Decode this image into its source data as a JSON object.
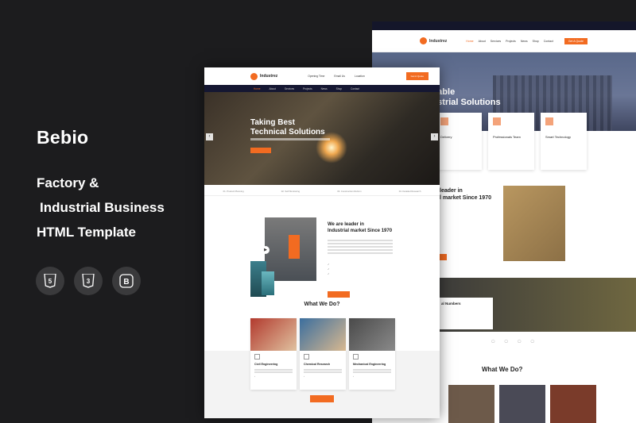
{
  "left": {
    "brand": "Bebio",
    "line1": "Factory &",
    "line2": "Industrial Business",
    "line3": "HTML Template",
    "badges": [
      "5",
      "3",
      "B"
    ]
  },
  "back": {
    "logo": "Industrez",
    "nav": [
      "Home",
      "About",
      "Services",
      "Projects",
      "News",
      "Shop",
      "Contact"
    ],
    "quote_btn": "Get A Quote",
    "hero_title_1": "Reliable",
    "hero_title_2": "ndustrial Solutions",
    "cards": [
      "Delivery",
      "Professionals Team",
      "Smart Technology"
    ],
    "leader_1": "leader in",
    "leader_2": "l market Since 1970",
    "numbers": "al Numbers",
    "wwd": "What We Do?"
  },
  "front": {
    "logo": "Industrez",
    "header_info": [
      "Opening Time",
      "Email Us",
      "Location"
    ],
    "quote_btn": "Get A Quote",
    "nav": [
      "Home",
      "About",
      "Services",
      "Projects",
      "News",
      "Shop",
      "Contact"
    ],
    "hero_line1": "Taking Best",
    "hero_line2": "Technical Solutions",
    "strip": [
      "01. Product Planning",
      "02. Self Monitoring",
      "03. Construction Reform",
      "04. Detailed Research"
    ],
    "about_title_1": "We are leader in",
    "about_title_2": "Industrial market Since 1970",
    "wwd_title": "What We Do?",
    "services": [
      {
        "name": "Civil Engineering"
      },
      {
        "name": "Chemical Research"
      },
      {
        "name": "Mechanical Engineering"
      }
    ]
  },
  "colors": {
    "accent": "#f26b21",
    "navy": "#151732",
    "bg": "#1c1c1e"
  }
}
